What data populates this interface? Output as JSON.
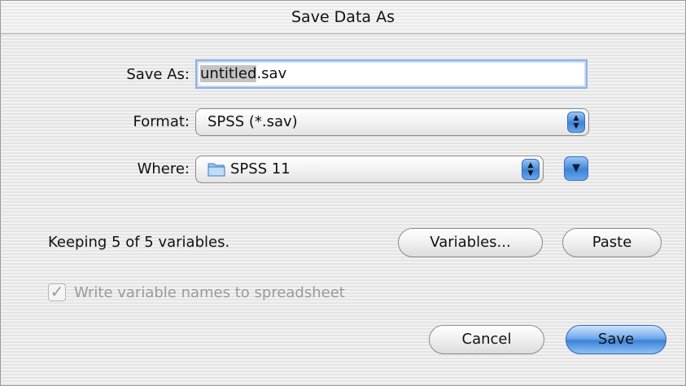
{
  "window": {
    "title": "Save Data As"
  },
  "save_as": {
    "label": "Save As:",
    "value_selected": "untitled",
    "value_rest": ".sav"
  },
  "format": {
    "label": "Format:",
    "value": "SPSS (*.sav)"
  },
  "where": {
    "label": "Where:",
    "value": "SPSS 11"
  },
  "status": {
    "text": "Keeping 5 of 5 variables."
  },
  "buttons": {
    "variables": "Variables...",
    "paste": "Paste",
    "cancel": "Cancel",
    "save": "Save"
  },
  "checkbox": {
    "label": "Write variable names to spreadsheet",
    "checked": true,
    "enabled": false
  }
}
